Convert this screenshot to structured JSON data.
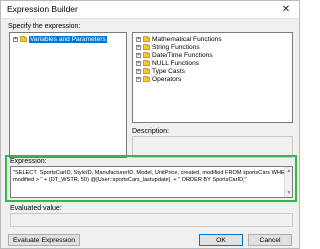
{
  "window": {
    "title": "Expression Builder"
  },
  "title_controls": {
    "close": "✕"
  },
  "specify_label": "Specify the expression:",
  "left_tree": [
    {
      "label": "Variables and Parameters",
      "selected": true
    }
  ],
  "right_tree": [
    {
      "label": "Mathematical Functions"
    },
    {
      "label": "String Functions"
    },
    {
      "label": "Date/Time Functions"
    },
    {
      "label": "NULL Functions"
    },
    {
      "label": "Type Casts"
    },
    {
      "label": "Operators"
    }
  ],
  "description_label": "Description:",
  "expression_label": "Expression:",
  "expression_lines": [
    "\"SELECT  SportsCarID, StyleID, ManufacturerID, Model, UnitPrice, created, modified FROM sportsCars WHERE",
    "modified > \" + (DT_WSTR, 50) @[User::sportsCars_lastupdate]  + \" ORDER BY SportsCarID;\""
  ],
  "evaluated_label": "Evaluated value:",
  "evaluated_value": "",
  "buttons": {
    "evaluate": "Evaluate Expression",
    "ok": "OK",
    "cancel": "Cancel"
  },
  "colors": {
    "highlight": "#3bb54a",
    "selection": "#0078d7"
  }
}
